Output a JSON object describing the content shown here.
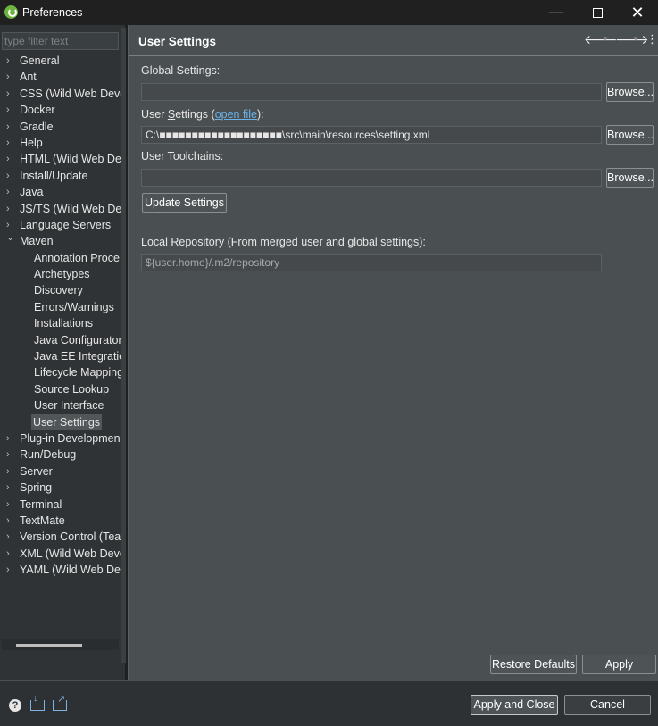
{
  "window": {
    "title": "Preferences",
    "minimize": "—",
    "close": "✕"
  },
  "sidebar": {
    "filter_placeholder": "type filter text",
    "items": [
      {
        "label": "General",
        "level": 0,
        "expanded": false
      },
      {
        "label": "Ant",
        "level": 0,
        "expanded": false
      },
      {
        "label": "CSS (Wild Web Deve",
        "level": 0,
        "expanded": false
      },
      {
        "label": "Docker",
        "level": 0,
        "expanded": false
      },
      {
        "label": "Gradle",
        "level": 0,
        "expanded": false
      },
      {
        "label": "Help",
        "level": 0,
        "expanded": false
      },
      {
        "label": "HTML (Wild Web De",
        "level": 0,
        "expanded": false
      },
      {
        "label": "Install/Update",
        "level": 0,
        "expanded": false
      },
      {
        "label": "Java",
        "level": 0,
        "expanded": false
      },
      {
        "label": "JS/TS (Wild Web Dev",
        "level": 0,
        "expanded": false
      },
      {
        "label": "Language Servers",
        "level": 0,
        "expanded": false
      },
      {
        "label": "Maven",
        "level": 0,
        "expanded": true
      },
      {
        "label": "Annotation Proce",
        "level": 1
      },
      {
        "label": "Archetypes",
        "level": 1
      },
      {
        "label": "Discovery",
        "level": 1
      },
      {
        "label": "Errors/Warnings",
        "level": 1
      },
      {
        "label": "Installations",
        "level": 1
      },
      {
        "label": "Java Configurator",
        "level": 1
      },
      {
        "label": "Java EE Integratio",
        "level": 1
      },
      {
        "label": "Lifecycle Mapping",
        "level": 1
      },
      {
        "label": "Source Lookup",
        "level": 1
      },
      {
        "label": "User Interface",
        "level": 1
      },
      {
        "label": "User Settings",
        "level": 1,
        "selected": true
      },
      {
        "label": "Plug-in Developmen",
        "level": 0,
        "expanded": false
      },
      {
        "label": "Run/Debug",
        "level": 0,
        "expanded": false
      },
      {
        "label": "Server",
        "level": 0,
        "expanded": false
      },
      {
        "label": "Spring",
        "level": 0,
        "expanded": false
      },
      {
        "label": "Terminal",
        "level": 0,
        "expanded": false
      },
      {
        "label": "TextMate",
        "level": 0,
        "expanded": false
      },
      {
        "label": "Version Control (Tea",
        "level": 0,
        "expanded": false
      },
      {
        "label": "XML (Wild Web Deve",
        "level": 0,
        "expanded": false
      },
      {
        "label": "YAML (Wild Web De",
        "level": 0,
        "expanded": false
      }
    ]
  },
  "page": {
    "title": "User Settings",
    "global_settings_label": "Global Settings:",
    "global_settings_value": "",
    "user_settings_label_prefix": "User ",
    "user_settings_label_u": "S",
    "user_settings_label_rest": "ettings (",
    "user_settings_link": "open file",
    "user_settings_label_suffix": "):",
    "user_settings_value": "C:\\■■■■■■■■■■■■■■■■■■■\\src\\main\\resources\\setting.xml",
    "user_toolchains_label": "User Toolchains:",
    "user_toolchains_value": "",
    "browse_label": "Browse...",
    "update_settings_label": "Update Settings",
    "local_repo_label": "Local Repository (From merged user and global settings):",
    "local_repo_value": "${user.home}/.m2/repository",
    "restore_defaults_label": "Restore Defaults",
    "apply_label": "Apply"
  },
  "footer": {
    "apply_close_label": "Apply and Close",
    "cancel_label": "Cancel",
    "help_icon": "?"
  },
  "icons": {
    "back": "🡐",
    "forward": "🡒",
    "menu": "⋮",
    "chevron_right": "›",
    "chevron_down": "⌄"
  }
}
